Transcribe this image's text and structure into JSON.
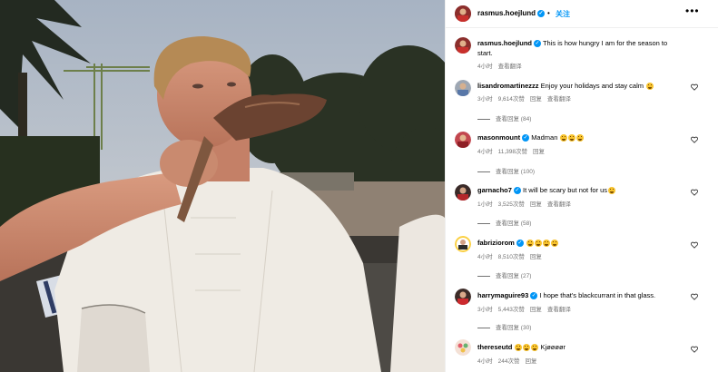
{
  "post": {
    "author": "rasmus.hoejlund",
    "follow_label": "关注",
    "more_icon": "more-icon"
  },
  "caption": {
    "username": "rasmus.hoejlund",
    "text": "This is how hungry I am for the season to",
    "text2": "start.",
    "time": "4小时",
    "translate": "查看翻译"
  },
  "comments": [
    {
      "username": "lisandromartinezzz",
      "text": "Enjoy your holidays and stay calm",
      "emoji_count": 1,
      "time": "3小时",
      "likes": "9,614次赞",
      "reply": "回复",
      "translate": "查看翻译",
      "replies": "查看回复 (84)"
    },
    {
      "username": "masonmount",
      "text": "Madman",
      "emoji_count": 3,
      "time": "4小时",
      "likes": "11,398次赞",
      "reply": "回复",
      "translate": "",
      "replies": "查看回复 (100)"
    },
    {
      "username": "garnacho7",
      "text": "It will be scary but not for us",
      "emoji_count": 1,
      "time": "1小时",
      "likes": "3,525次赞",
      "reply": "回复",
      "translate": "查看翻译",
      "replies": "查看回复 (58)"
    },
    {
      "username": "fabriziorom",
      "text": "",
      "emoji_count": 4,
      "time": "4小时",
      "likes": "8,510次赞",
      "reply": "回复",
      "translate": "",
      "replies": "查看回复 (27)"
    },
    {
      "username": "harrymaguire93",
      "text": "I hope that's blackcurrant in that glass.",
      "emoji_count": 0,
      "time": "3小时",
      "likes": "5,443次赞",
      "reply": "回复",
      "translate": "查看翻译",
      "replies": "查看回复 (30)"
    },
    {
      "username": "thereseutd",
      "text": "Kjøøøør",
      "emoji_count": 3,
      "time": "4小时",
      "likes": "244次赞",
      "reply": "回复",
      "translate": "",
      "replies": ""
    }
  ]
}
